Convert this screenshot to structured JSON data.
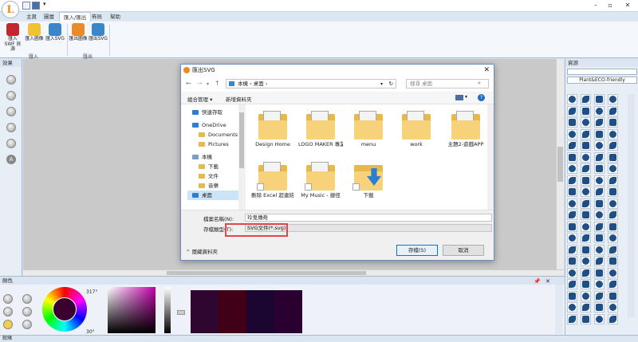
{
  "app": {
    "logo_letter": "L",
    "accent": "#f08a1a",
    "window_controls": [
      "–",
      "▫",
      "✕"
    ]
  },
  "tabs": [
    "主頁",
    "圖層",
    "匯入/匯出",
    "佈局",
    "幫助"
  ],
  "active_tab": "匯入/匯出",
  "ribbon": {
    "groups": [
      {
        "label": "匯入",
        "buttons": [
          "匯入\nSWF 資源",
          "匯入圖像",
          "匯入SVG"
        ]
      },
      {
        "label": "匯出",
        "buttons": [
          "匯出圖像",
          "匯出SVG"
        ]
      }
    ]
  },
  "left_panel": {
    "title": "效果"
  },
  "right_panel": {
    "title": "資源",
    "category": "Plant&ECO-friendly"
  },
  "bottom_panel": {
    "title": "顏色",
    "hue_angle": "317°",
    "sat_angle": "30°",
    "swatches": [
      "#2e0630",
      "#420018",
      "#1a0630",
      "#2a0030"
    ]
  },
  "status": "就緒",
  "dialog": {
    "title": "匯出SVG",
    "path": [
      "本機",
      "桌面"
    ],
    "search_placeholder": "搜尋 桌面",
    "toolbar": {
      "organize": "組合管理 ▾",
      "new_folder": "新增資料夾"
    },
    "tree": [
      {
        "label": "快速存取",
        "color": "#2b7fd3"
      },
      {
        "label": "OneDrive",
        "color": "#2b7fd3"
      },
      {
        "label": "Documents",
        "color": "#e8b84a"
      },
      {
        "label": "Pictures",
        "color": "#e8b84a"
      },
      {
        "label": "本機",
        "color": "#7a9cc6"
      },
      {
        "label": "下載",
        "color": "#e8b84a"
      },
      {
        "label": "文件",
        "color": "#e8b84a"
      },
      {
        "label": "音樂",
        "color": "#e8b84a"
      },
      {
        "label": "桌面",
        "color": "#2b7fd3"
      }
    ],
    "files": [
      "Design Home",
      "LOGO MAKER 專業版",
      "menu",
      "work",
      "主題2-遊戲APP",
      "刪除 Excel 超連結",
      "My Music - 捷徑",
      "下載"
    ],
    "filename_label": "檔案名稱(N):",
    "filename_value": "玲鬼傳奇",
    "filetype_label": "存檔類型(T):",
    "filetype_value": "SVG文件(*.svg)",
    "hide_folders": "隱藏資料夾",
    "save": "存檔(S)",
    "cancel": "取消"
  }
}
